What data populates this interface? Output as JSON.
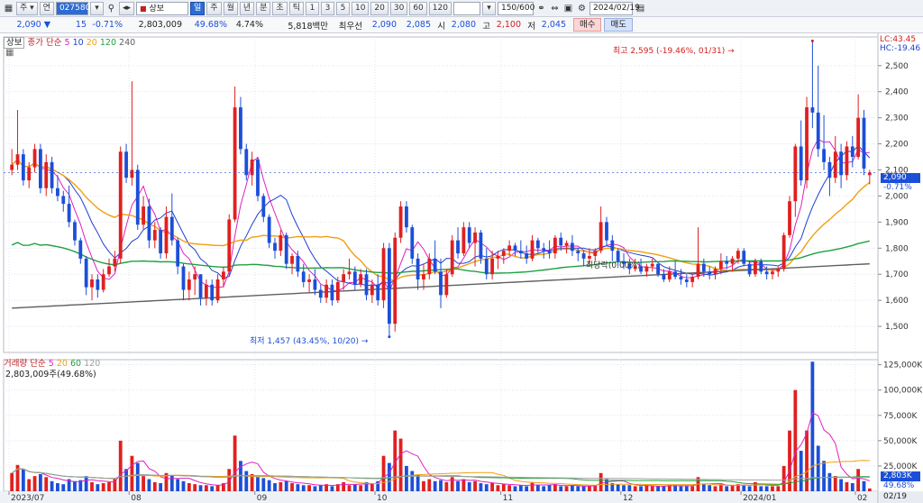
{
  "toolbar": {
    "period_label": "주",
    "cont_label": "연",
    "code_value": "027580",
    "stock_name": "상보",
    "period_tabs": [
      "일",
      "주",
      "월",
      "년",
      "분",
      "초",
      "틱"
    ],
    "intervals": [
      "1",
      "3",
      "5",
      "10",
      "20",
      "30",
      "60",
      "120"
    ],
    "count": "150/600",
    "date": "2024/02/19"
  },
  "quote": {
    "price": "2,090",
    "change": "15",
    "change_pct": "-0.71%",
    "volume": "2,803,009",
    "volume_ratio": "49.68%",
    "turnover": "4.74%",
    "amount": "5,818백만",
    "best_bid_label": "최우선",
    "best_bid": "2,090",
    "best_ask": "2,085",
    "open_label": "시",
    "open": "2,080",
    "high_label": "고",
    "high": "2,100",
    "low_label": "저",
    "low": "2,045",
    "buy_label": "매수",
    "sell_label": "매도"
  },
  "price_pane": {
    "legend_name": "상보",
    "legend_ma": "종가 단순",
    "ma_periods": [
      "5",
      "10",
      "20",
      "120",
      "240"
    ],
    "ma_colors": [
      "#e020c0",
      "#2040d0",
      "#f0a010",
      "#20a040",
      "#606060"
    ],
    "lc_label": "LC:43.45",
    "hc_label": "HC:-19.46",
    "current_price": "2,090",
    "current_pct": "-0.71%",
    "max_annotation": "최고 2,595 (-19.46%, 01/31)",
    "min_annotation": "최저 1,457 (43.45%, 10/20)",
    "stop_annotation": "최당락(0.00%)"
  },
  "volume_pane": {
    "legend_name": "거래량",
    "legend_ma": "단순",
    "ma_periods": [
      "5",
      "20",
      "60",
      "120"
    ],
    "ma_colors": [
      "#e020c0",
      "#f0a010",
      "#20a040",
      "#a0a0a0"
    ],
    "current_volume": "2,803,009주(49.68%)",
    "current_tag": "2,803K",
    "current_pct": "49.68%"
  },
  "x_axis": {
    "labels": [
      "2023/07",
      "08",
      "09",
      "10",
      "11",
      "12",
      "2024/01",
      "02"
    ],
    "last_date": "02/19"
  },
  "chart_data": {
    "type": "candlestick",
    "price_axis": {
      "ticks": [
        "1,500",
        "1,600",
        "1,700",
        "1,800",
        "1,900",
        "2,000",
        "2,100",
        "2,200",
        "2,300",
        "2,400",
        "2,500"
      ],
      "ylim": [
        1400,
        2610
      ]
    },
    "volume_axis": {
      "ticks": [
        "25,000K",
        "50,000K",
        "75,000K",
        "100,000K",
        "125,000K"
      ],
      "ylim": [
        0,
        130000
      ]
    },
    "candles": [
      [
        2100,
        2180,
        2080,
        2120,
        18000
      ],
      [
        2120,
        2330,
        2100,
        2160,
        26000
      ],
      [
        2160,
        2180,
        2040,
        2060,
        22000
      ],
      [
        2060,
        2130,
        2030,
        2110,
        12000
      ],
      [
        2110,
        2200,
        2090,
        2180,
        15000
      ],
      [
        2180,
        2200,
        2010,
        2030,
        17000
      ],
      [
        2030,
        2160,
        2000,
        2130,
        14000
      ],
      [
        2130,
        2150,
        2010,
        2030,
        10000
      ],
      [
        2030,
        2080,
        1980,
        2000,
        8000
      ],
      [
        2000,
        2020,
        1940,
        1970,
        7000
      ],
      [
        1970,
        2040,
        1880,
        1900,
        12000
      ],
      [
        1900,
        1910,
        1810,
        1830,
        10000
      ],
      [
        1830,
        1840,
        1740,
        1760,
        11000
      ],
      [
        1760,
        1770,
        1620,
        1650,
        15000
      ],
      [
        1650,
        1700,
        1600,
        1680,
        9000
      ],
      [
        1680,
        1700,
        1610,
        1640,
        7000
      ],
      [
        1640,
        1720,
        1630,
        1700,
        8000
      ],
      [
        1700,
        1760,
        1690,
        1730,
        9000
      ],
      [
        1730,
        1790,
        1710,
        1760,
        12000
      ],
      [
        1760,
        2190,
        1740,
        2170,
        50000
      ],
      [
        2170,
        2200,
        2050,
        2070,
        22000
      ],
      [
        2070,
        2440,
        2040,
        2100,
        35000
      ],
      [
        2100,
        2120,
        1870,
        1890,
        28000
      ],
      [
        1890,
        2000,
        1870,
        1960,
        15000
      ],
      [
        1960,
        1990,
        1800,
        1830,
        12000
      ],
      [
        1830,
        1900,
        1800,
        1870,
        9000
      ],
      [
        1870,
        1880,
        1760,
        1780,
        8000
      ],
      [
        1780,
        1960,
        1760,
        1920,
        18000
      ],
      [
        1920,
        2010,
        1810,
        1830,
        16000
      ],
      [
        1830,
        1840,
        1700,
        1730,
        12000
      ],
      [
        1730,
        1740,
        1600,
        1640,
        10000
      ],
      [
        1640,
        1710,
        1600,
        1680,
        8000
      ],
      [
        1680,
        1730,
        1620,
        1700,
        7000
      ],
      [
        1700,
        1700,
        1580,
        1610,
        6000
      ],
      [
        1610,
        1680,
        1580,
        1660,
        6000
      ],
      [
        1660,
        1680,
        1580,
        1600,
        5000
      ],
      [
        1600,
        1700,
        1590,
        1680,
        6000
      ],
      [
        1680,
        1730,
        1650,
        1710,
        8000
      ],
      [
        1710,
        1930,
        1690,
        1910,
        22000
      ],
      [
        1910,
        2420,
        1900,
        2340,
        55000
      ],
      [
        2340,
        2380,
        2160,
        2180,
        30000
      ],
      [
        2180,
        2200,
        2060,
        2080,
        20000
      ],
      [
        2080,
        2170,
        2040,
        2140,
        17000
      ],
      [
        2140,
        2150,
        1980,
        2000,
        14000
      ],
      [
        2000,
        2010,
        1900,
        1920,
        13000
      ],
      [
        1920,
        1930,
        1800,
        1820,
        11000
      ],
      [
        1820,
        1840,
        1760,
        1790,
        8000
      ],
      [
        1790,
        1870,
        1770,
        1850,
        9000
      ],
      [
        1850,
        1860,
        1720,
        1740,
        10000
      ],
      [
        1740,
        1780,
        1700,
        1770,
        8000
      ],
      [
        1770,
        1790,
        1690,
        1710,
        7000
      ],
      [
        1710,
        1740,
        1650,
        1670,
        6000
      ],
      [
        1670,
        1700,
        1630,
        1680,
        6000
      ],
      [
        1680,
        1720,
        1620,
        1640,
        5000
      ],
      [
        1640,
        1660,
        1590,
        1610,
        6000
      ],
      [
        1610,
        1680,
        1590,
        1660,
        7000
      ],
      [
        1660,
        1680,
        1580,
        1600,
        5000
      ],
      [
        1600,
        1690,
        1590,
        1670,
        7000
      ],
      [
        1670,
        1720,
        1640,
        1700,
        9000
      ],
      [
        1700,
        1760,
        1680,
        1710,
        6000
      ],
      [
        1710,
        1730,
        1640,
        1660,
        7000
      ],
      [
        1660,
        1720,
        1650,
        1700,
        6000
      ],
      [
        1700,
        1720,
        1600,
        1620,
        9000
      ],
      [
        1620,
        1680,
        1590,
        1660,
        8000
      ],
      [
        1660,
        1700,
        1580,
        1600,
        10000
      ],
      [
        1600,
        1820,
        1570,
        1800,
        35000
      ],
      [
        1800,
        1820,
        1460,
        1510,
        28000
      ],
      [
        1510,
        1860,
        1480,
        1840,
        60000
      ],
      [
        1840,
        1980,
        1820,
        1960,
        52000
      ],
      [
        1960,
        1980,
        1860,
        1880,
        25000
      ],
      [
        1880,
        1890,
        1740,
        1760,
        20000
      ],
      [
        1760,
        1780,
        1640,
        1680,
        16000
      ],
      [
        1680,
        1740,
        1640,
        1700,
        10000
      ],
      [
        1700,
        1780,
        1680,
        1760,
        12000
      ],
      [
        1760,
        1830,
        1700,
        1710,
        10000
      ],
      [
        1710,
        1760,
        1570,
        1620,
        11000
      ],
      [
        1620,
        1720,
        1610,
        1700,
        9000
      ],
      [
        1700,
        1850,
        1690,
        1830,
        14000
      ],
      [
        1830,
        1880,
        1760,
        1780,
        10000
      ],
      [
        1780,
        1900,
        1770,
        1880,
        12000
      ],
      [
        1880,
        1900,
        1800,
        1820,
        9000
      ],
      [
        1820,
        1880,
        1730,
        1860,
        10000
      ],
      [
        1860,
        1870,
        1740,
        1760,
        8000
      ],
      [
        1760,
        1800,
        1680,
        1700,
        7000
      ],
      [
        1700,
        1790,
        1680,
        1760,
        8000
      ],
      [
        1760,
        1790,
        1720,
        1770,
        6000
      ],
      [
        1770,
        1800,
        1740,
        1790,
        7000
      ],
      [
        1790,
        1830,
        1770,
        1810,
        6000
      ],
      [
        1810,
        1820,
        1770,
        1790,
        5000
      ],
      [
        1790,
        1830,
        1760,
        1780,
        6000
      ],
      [
        1780,
        1810,
        1740,
        1760,
        5000
      ],
      [
        1760,
        1850,
        1750,
        1830,
        9000
      ],
      [
        1830,
        1840,
        1780,
        1800,
        6000
      ],
      [
        1800,
        1820,
        1760,
        1790,
        5000
      ],
      [
        1790,
        1830,
        1760,
        1780,
        6000
      ],
      [
        1780,
        1850,
        1760,
        1840,
        7000
      ],
      [
        1840,
        1860,
        1790,
        1810,
        5000
      ],
      [
        1810,
        1830,
        1780,
        1820,
        5000
      ],
      [
        1820,
        1850,
        1770,
        1790,
        6000
      ],
      [
        1790,
        1800,
        1750,
        1780,
        5000
      ],
      [
        1780,
        1790,
        1730,
        1760,
        5000
      ],
      [
        1760,
        1800,
        1740,
        1770,
        5000
      ],
      [
        1770,
        1800,
        1750,
        1790,
        6000
      ],
      [
        1790,
        1960,
        1780,
        1900,
        18000
      ],
      [
        1900,
        1920,
        1810,
        1830,
        12000
      ],
      [
        1830,
        1850,
        1750,
        1790,
        8000
      ],
      [
        1790,
        1800,
        1730,
        1750,
        7000
      ],
      [
        1750,
        1780,
        1720,
        1740,
        6000
      ],
      [
        1740,
        1760,
        1700,
        1720,
        6000
      ],
      [
        1720,
        1760,
        1710,
        1730,
        5000
      ],
      [
        1730,
        1760,
        1700,
        1710,
        5000
      ],
      [
        1710,
        1740,
        1690,
        1730,
        6000
      ],
      [
        1730,
        1760,
        1710,
        1740,
        5000
      ],
      [
        1740,
        1740,
        1690,
        1700,
        5000
      ],
      [
        1700,
        1720,
        1670,
        1680,
        5000
      ],
      [
        1680,
        1730,
        1670,
        1710,
        6000
      ],
      [
        1710,
        1750,
        1680,
        1690,
        6000
      ],
      [
        1690,
        1720,
        1660,
        1680,
        5000
      ],
      [
        1680,
        1700,
        1650,
        1670,
        5000
      ],
      [
        1670,
        1700,
        1650,
        1690,
        5000
      ],
      [
        1690,
        1880,
        1680,
        1740,
        14000
      ],
      [
        1740,
        1760,
        1690,
        1710,
        7000
      ],
      [
        1710,
        1730,
        1680,
        1700,
        6000
      ],
      [
        1700,
        1730,
        1680,
        1720,
        5000
      ],
      [
        1720,
        1780,
        1700,
        1750,
        7000
      ],
      [
        1750,
        1770,
        1720,
        1740,
        5000
      ],
      [
        1740,
        1770,
        1710,
        1760,
        6000
      ],
      [
        1760,
        1800,
        1740,
        1790,
        7000
      ],
      [
        1790,
        1800,
        1730,
        1740,
        6000
      ],
      [
        1740,
        1750,
        1690,
        1700,
        5000
      ],
      [
        1700,
        1760,
        1690,
        1750,
        9000
      ],
      [
        1750,
        1760,
        1700,
        1710,
        5000
      ],
      [
        1710,
        1730,
        1680,
        1700,
        5000
      ],
      [
        1700,
        1720,
        1680,
        1710,
        5000
      ],
      [
        1710,
        1730,
        1690,
        1720,
        5000
      ],
      [
        1720,
        1860,
        1710,
        1850,
        25000
      ],
      [
        1850,
        2000,
        1840,
        1980,
        60000
      ],
      [
        1980,
        2200,
        1920,
        2190,
        100000
      ],
      [
        2190,
        2290,
        2040,
        2060,
        40000
      ],
      [
        2060,
        2380,
        2030,
        2340,
        60000
      ],
      [
        2340,
        2595,
        2260,
        2320,
        128000
      ],
      [
        2320,
        2500,
        2150,
        2180,
        45000
      ],
      [
        2180,
        2310,
        2100,
        2130,
        30000
      ],
      [
        2130,
        2150,
        2000,
        2070,
        18000
      ],
      [
        2070,
        2230,
        2050,
        2170,
        15000
      ],
      [
        2170,
        2200,
        2030,
        2080,
        12000
      ],
      [
        2080,
        2210,
        2060,
        2190,
        9000
      ],
      [
        2190,
        2230,
        2110,
        2150,
        8000
      ],
      [
        2150,
        2390,
        2140,
        2300,
        22000
      ],
      [
        2300,
        2330,
        2080,
        2105,
        10000
      ],
      [
        2080,
        2100,
        2045,
        2090,
        2803
      ]
    ]
  }
}
